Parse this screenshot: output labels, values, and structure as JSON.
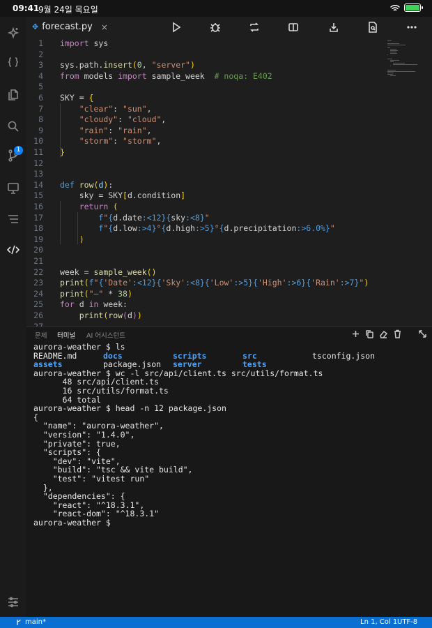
{
  "status_bar": {
    "time": "09:41",
    "date": "9월 24일 목요일",
    "battery_color": "#3fd35b"
  },
  "activity_bar": {
    "source_control_badge": "1"
  },
  "tab": {
    "filename": "forecast.py",
    "close": "×"
  },
  "editor": {
    "lines": [
      {
        "n": "1",
        "html": "<span class='k'>import</span> sys"
      },
      {
        "n": "2",
        "html": ""
      },
      {
        "n": "3",
        "html": "sys.path.<span class='fn'>insert</span><span class='p1'>(</span><span class='n'>0</span>, <span class='s'>\"server\"</span><span class='p1'>)</span>"
      },
      {
        "n": "4",
        "html": "<span class='k'>from</span> models <span class='k'>import</span> sample_week  <span class='c'># noqa: E402</span>"
      },
      {
        "n": "5",
        "html": ""
      },
      {
        "n": "6",
        "html": "SKY = <span class='p1'>{</span>"
      },
      {
        "n": "7",
        "html": "    <span class='s'>\"clear\"</span>: <span class='s'>\"sun\"</span>,"
      },
      {
        "n": "8",
        "html": "    <span class='s'>\"cloudy\"</span>: <span class='s'>\"cloud\"</span>,"
      },
      {
        "n": "9",
        "html": "    <span class='s'>\"rain\"</span>: <span class='s'>\"rain\"</span>,"
      },
      {
        "n": "10",
        "html": "    <span class='s'>\"storm\"</span>: <span class='s'>\"storm\"</span>,"
      },
      {
        "n": "11",
        "html": "<span class='p1'>}</span>"
      },
      {
        "n": "12",
        "html": ""
      },
      {
        "n": "13",
        "html": ""
      },
      {
        "n": "14",
        "html": "<span class='kb'>def</span> <span class='fn'>row</span><span class='p1'>(</span><span class='v'>d</span><span class='p1'>)</span>:"
      },
      {
        "n": "15",
        "html": "    sky = SKY<span class='p1'>[</span>d.condition<span class='p1'>]</span>"
      },
      {
        "n": "16",
        "html": "    <span class='k'>return</span> <span class='p1'>(</span>"
      },
      {
        "n": "17",
        "html": "        <span class='kb'>f</span><span class='s'>\"</span><span class='fmt'>{</span>d.date<span class='fmt'>:&lt;12}{</span>sky<span class='fmt'>:&lt;8}</span><span class='s'>\"</span>"
      },
      {
        "n": "18",
        "html": "        <span class='kb'>f</span><span class='s'>\"</span><span class='fmt'>{</span>d.low<span class='fmt'>:&gt;4}</span><span class='s'>°</span><span class='fmt'>{</span>d.high<span class='fmt'>:&gt;5}</span><span class='s'>°</span><span class='fmt'>{</span>d.precipitation<span class='fmt'>:&gt;6.0%}</span><span class='s'>\"</span>"
      },
      {
        "n": "19",
        "html": "    <span class='p1'>)</span>"
      },
      {
        "n": "20",
        "html": ""
      },
      {
        "n": "21",
        "html": ""
      },
      {
        "n": "22",
        "html": "week = <span class='fn'>sample_week</span><span class='p1'>()</span>"
      },
      {
        "n": "23",
        "html": "<span class='fn'>print</span><span class='p1'>(</span><span class='kb'>f</span><span class='s'>\"</span><span class='fmt'>{</span><span class='s'>'Date'</span><span class='fmt'>:&lt;12}{</span><span class='s'>'Sky'</span><span class='fmt'>:&lt;8}{</span><span class='s'>'Low'</span><span class='fmt'>:&gt;5}{</span><span class='s'>'High'</span><span class='fmt'>:&gt;6}{</span><span class='s'>'Rain'</span><span class='fmt'>:&gt;7}</span><span class='s'>\"</span><span class='p1'>)</span>"
      },
      {
        "n": "24",
        "html": "<span class='fn'>print</span><span class='p1'>(</span><span class='s'>\"—\"</span> * <span class='n'>38</span><span class='p1'>)</span>"
      },
      {
        "n": "25",
        "html": "<span class='k'>for</span> d <span class='k'>in</span> week:"
      },
      {
        "n": "26",
        "html": "    <span class='fn'>print</span><span class='p1'>(</span><span class='fn'>row</span><span class='p2'>(</span>d<span class='p2'>)</span><span class='p1'>)</span>"
      },
      {
        "n": "27",
        "html": ""
      }
    ]
  },
  "panel": {
    "tabs": [
      "문제",
      "터미널",
      "AI 어시스턴트"
    ],
    "active_tab": "터미널"
  },
  "terminal": {
    "prompt1": "aurora-weather $ ls",
    "ls_rows": [
      [
        {
          "t": "README.md",
          "dir": false
        },
        {
          "t": "docs",
          "dir": true
        },
        {
          "t": "scripts",
          "dir": true
        },
        {
          "t": "src",
          "dir": true
        },
        {
          "t": "tsconfig.json",
          "dir": false
        }
      ],
      [
        {
          "t": "assets",
          "dir": true
        },
        {
          "t": "package.json",
          "dir": false
        },
        {
          "t": "server",
          "dir": true
        },
        {
          "t": "tests",
          "dir": true
        }
      ]
    ],
    "lines": [
      "aurora-weather $ wc -l src/api/client.ts src/utils/format.ts",
      "      48 src/api/client.ts",
      "      16 src/utils/format.ts",
      "      64 total",
      "aurora-weather $ head -n 12 package.json",
      "{",
      "  \"name\": \"aurora-weather\",",
      "  \"version\": \"1.4.0\",",
      "  \"private\": true,",
      "  \"scripts\": {",
      "    \"dev\": \"vite\",",
      "    \"build\": \"tsc && vite build\",",
      "    \"test\": \"vitest run\"",
      "  },",
      "  \"dependencies\": {",
      "    \"react\": \"^18.3.1\",",
      "    \"react-dom\": \"^18.3.1\"",
      "aurora-weather $"
    ]
  },
  "bottom_bar": {
    "branch": "main*",
    "cursor": "Ln 1, Col 1",
    "encoding": "UTF-8",
    "color": "#0a6fd0"
  }
}
